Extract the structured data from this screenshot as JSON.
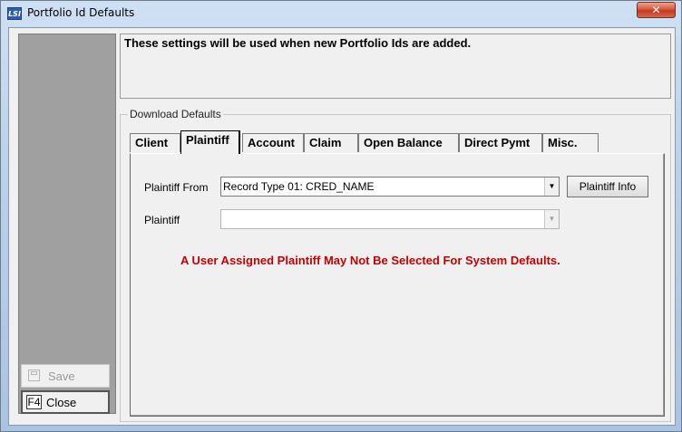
{
  "window": {
    "title": "Portfolio Id Defaults",
    "app_icon_text": "LSI",
    "close_glyph": "✕"
  },
  "info": {
    "text": "These settings will be used when new Portfolio Ids are added."
  },
  "download_defaults": {
    "legend": "Download Defaults",
    "tabs": [
      {
        "label": "Client"
      },
      {
        "label": "Plaintiff",
        "active": true
      },
      {
        "label": "Account"
      },
      {
        "label": "Claim"
      },
      {
        "label": "Open Balance"
      },
      {
        "label": "Direct Pymt"
      },
      {
        "label": "Misc."
      }
    ],
    "plaintiff_tab": {
      "plaintiff_from_label": "Plaintiff From",
      "plaintiff_from_value": "Record Type 01: CRED_NAME",
      "plaintiff_info_button": "Plaintiff Info",
      "plaintiff_label": "Plaintiff",
      "plaintiff_value": "",
      "warning": "A User Assigned Plaintiff May Not Be Selected For System Defaults."
    }
  },
  "sidebar": {
    "save_label": "Save",
    "close_label": "Close",
    "close_key": "F4"
  },
  "colors": {
    "warning": "#c00000",
    "sidebar_panel": "#a0a0a0"
  },
  "icons": {
    "dropdown": "▼"
  }
}
